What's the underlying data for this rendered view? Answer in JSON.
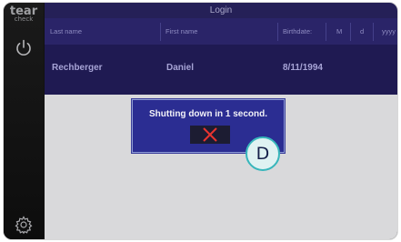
{
  "sidebar": {
    "logo_top": "tear",
    "logo_bottom": "check",
    "power_icon": "power-icon",
    "settings_icon": "gear-icon"
  },
  "header": {
    "title": "Login"
  },
  "table": {
    "columns": [
      "Last name",
      "First name",
      "Birthdate:",
      "M",
      "d",
      "yyyy"
    ],
    "rows": [
      {
        "last_name": "Rechberger",
        "first_name": "Daniel",
        "birthdate": "8/11/1994"
      }
    ]
  },
  "dialog": {
    "message": "Shutting down in 1 second.",
    "close_icon": "close-icon"
  },
  "marker": {
    "label": "D"
  },
  "colors": {
    "sidebar_bg": "#111111",
    "title_bar": "#252057",
    "header_row": "#2a2468",
    "data_row": "#1f1a52",
    "dialog_bg": "#2b2d92",
    "close_x": "#e8342f",
    "marker_border": "#37b6bb",
    "content_bg": "#d9d9db"
  }
}
